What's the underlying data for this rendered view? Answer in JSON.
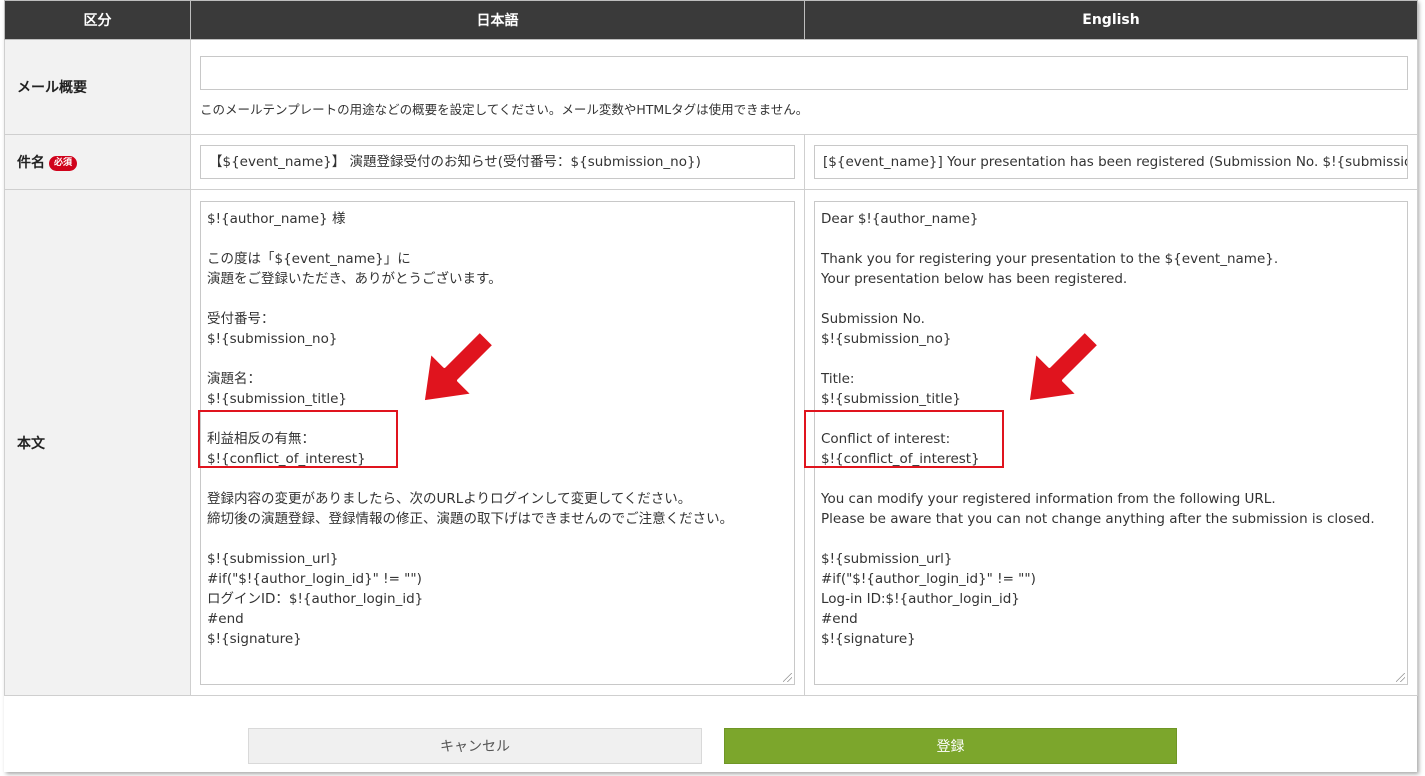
{
  "header": {
    "col_category": "区分",
    "col_japanese": "日本語",
    "col_english": "English"
  },
  "rows": {
    "summary": {
      "label": "メール概要",
      "value": "",
      "help": "このメールテンプレートの用途などの概要を設定してください。メール変数やHTMLタグは使用できません。"
    },
    "subject": {
      "label": "件名",
      "required_badge": "必須",
      "ja_value": "【${event_name}】 演題登録受付のお知らせ(受付番号：${submission_no})",
      "en_value": "[${event_name}] Your presentation has been registered (Submission No. $!{submission_no})"
    },
    "body": {
      "label": "本文",
      "ja_lines": [
        "$!{author_name} 様",
        "",
        "この度は「${event_name}」に",
        "演題をご登録いただき、ありがとうございます。",
        "",
        "受付番号：",
        "$!{submission_no}",
        "",
        "演題名：",
        "$!{submission_title}",
        "",
        "利益相反の有無：",
        "$!{conflict_of_interest}",
        "",
        "登録内容の変更がありましたら、次のURLよりログインして変更してください。",
        "締切後の演題登録、登録情報の修正、演題の取下げはできませんのでご注意ください。",
        "",
        "$!{submission_url}",
        "#if(\"$!{author_login_id}\" != \"\")",
        "ログインID：$!{author_login_id}",
        "#end",
        "$!{signature}"
      ],
      "en_lines": [
        "Dear $!{author_name}",
        "",
        "Thank you for registering your presentation to the ${event_name}.",
        "Your presentation below has been registered.",
        "",
        "Submission No.",
        "$!{submission_no}",
        "",
        "Title:",
        "$!{submission_title}",
        "",
        "Conflict of interest:",
        "$!{conflict_of_interest}",
        "",
        "You can modify your registered information from the following URL.",
        "Please be aware that you can not change anything after the submission is closed.",
        "",
        "$!{submission_url}",
        "#if(\"$!{author_login_id}\" != \"\")",
        "Log-in ID:$!{author_login_id}",
        "#end",
        "$!{signature}"
      ]
    }
  },
  "buttons": {
    "cancel": "キャンセル",
    "submit": "登録"
  },
  "colors": {
    "header_bg": "#3a3a3a",
    "label_bg": "#f2f2f2",
    "required_badge": "#d0021b",
    "submit_green": "#7ca62c",
    "highlight_red": "#e0141e"
  },
  "annotations": {
    "arrow_icon": "red-arrow-icon",
    "highlight": "red-highlight-box"
  }
}
